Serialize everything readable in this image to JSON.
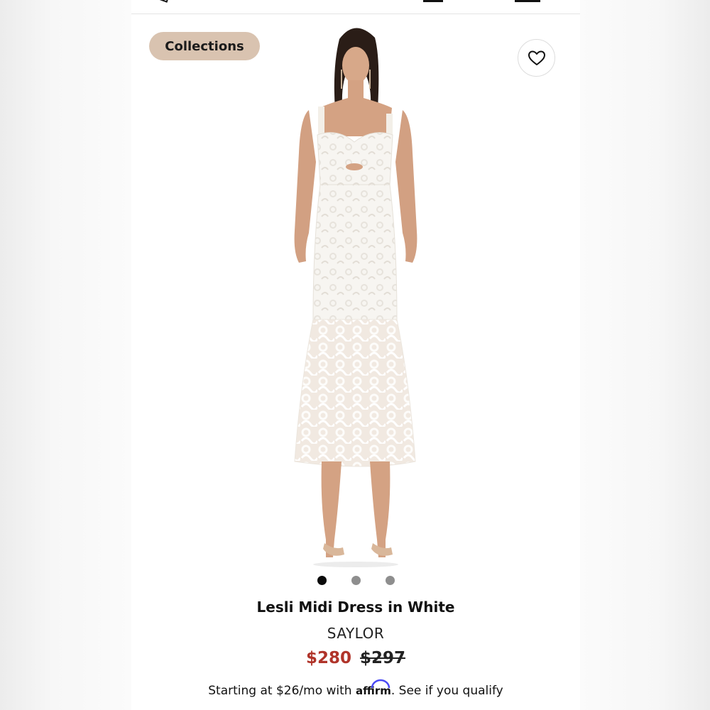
{
  "badge": {
    "label": "Collections"
  },
  "icons": {
    "favorite": "heart-outline-icon",
    "carousel": "pagination-dots"
  },
  "carousel": {
    "count": 3,
    "active": 0
  },
  "product": {
    "name": "Lesli Midi Dress in White",
    "brand": "SAYLOR",
    "sale_price": "$280",
    "original_price": "$297"
  },
  "financing": {
    "prefix": "Starting at $26/mo with",
    "provider": "affirm",
    "suffix": ". See if you qualify"
  },
  "colors": {
    "badge_bg": "#d9c3b0",
    "sale_price": "#b0342a",
    "affirm_accent": "#4a4af4",
    "dot_active": "#0a0a0a",
    "dot_inactive": "#8e8e8e"
  }
}
